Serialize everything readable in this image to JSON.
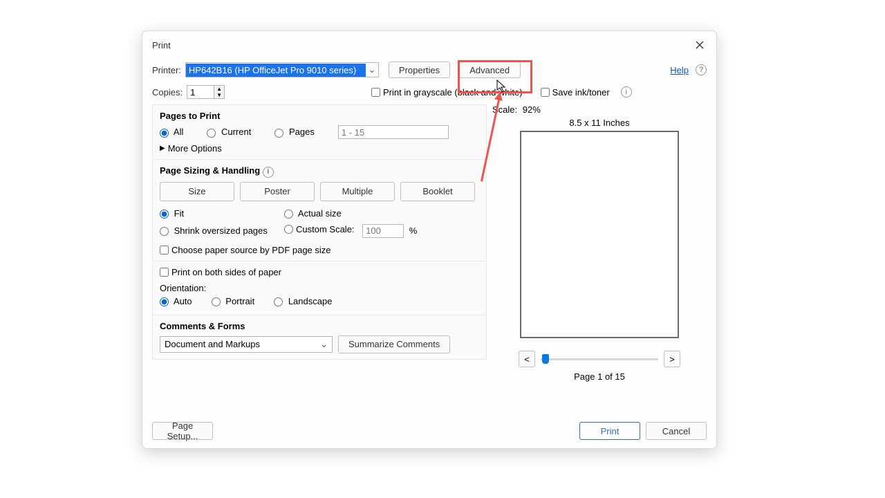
{
  "title": "Print",
  "printer": {
    "label": "Printer:",
    "selected": "HP642B16 (HP OfficeJet Pro 9010 series)",
    "properties": "Properties",
    "advanced": "Advanced"
  },
  "copies": {
    "label": "Copies:",
    "value": "1"
  },
  "grayscale": "Print in grayscale (black and white)",
  "saveink": "Save ink/toner",
  "help": "Help",
  "pages_to_print": {
    "title": "Pages to Print",
    "all": "All",
    "current": "Current",
    "pages": "Pages",
    "range": "1 - 15",
    "more": "More Options"
  },
  "sizing": {
    "title": "Page Sizing & Handling",
    "size": "Size",
    "poster": "Poster",
    "multiple": "Multiple",
    "booklet": "Booklet",
    "fit": "Fit",
    "actual": "Actual size",
    "shrink": "Shrink oversized pages",
    "custom": "Custom Scale:",
    "custom_val": "100",
    "percent": "%",
    "choose_source": "Choose paper source by PDF page size",
    "duplex": "Print on both sides of paper",
    "orientation": "Orientation:",
    "auto": "Auto",
    "portrait": "Portrait",
    "landscape": "Landscape"
  },
  "comments": {
    "title": "Comments & Forms",
    "selected": "Document and Markups",
    "summarize": "Summarize Comments"
  },
  "preview": {
    "scale_label": "Scale:",
    "scale_val": "92%",
    "dims": "8.5 x 11 Inches",
    "page_of": "Page 1 of 15"
  },
  "footer": {
    "page_setup": "Page Setup...",
    "print": "Print",
    "cancel": "Cancel"
  }
}
